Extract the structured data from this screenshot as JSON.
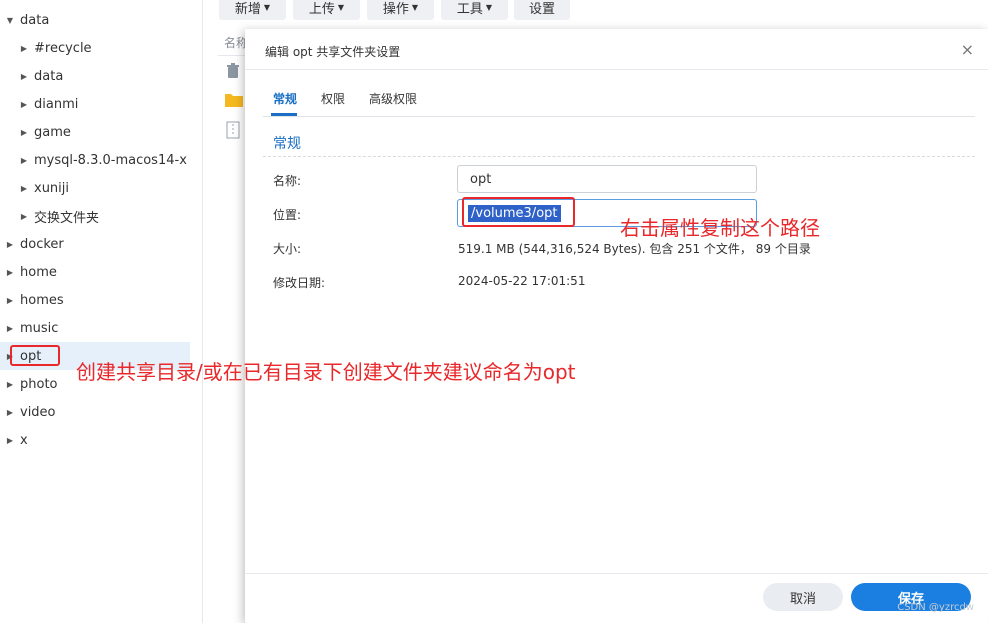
{
  "tree": {
    "items": [
      {
        "label": "data",
        "level": 0,
        "expanded": true
      },
      {
        "label": "#recycle",
        "level": 1
      },
      {
        "label": "data",
        "level": 1
      },
      {
        "label": "dianmi",
        "level": 1
      },
      {
        "label": "game",
        "level": 1
      },
      {
        "label": "mysql-8.3.0-macos14-x",
        "level": 1
      },
      {
        "label": "xuniji",
        "level": 1
      },
      {
        "label": "交换文件夹",
        "level": 1
      },
      {
        "label": "docker",
        "level": 0
      },
      {
        "label": "home",
        "level": 0
      },
      {
        "label": "homes",
        "level": 0
      },
      {
        "label": "music",
        "level": 0
      },
      {
        "label": "opt",
        "level": 0,
        "selected": true
      },
      {
        "label": "photo",
        "level": 0
      },
      {
        "label": "video",
        "level": 0
      },
      {
        "label": "x",
        "level": 0
      }
    ]
  },
  "toolbar": {
    "new_label": "新增",
    "upload_label": "上传",
    "action_label": "操作",
    "tools_label": "工具",
    "settings_label": "设置"
  },
  "filelist": {
    "header": "名称"
  },
  "dialog": {
    "title": "编辑 opt 共享文件夹设置",
    "close": "×",
    "tabs": [
      "常规",
      "权限",
      "高级权限"
    ],
    "section_title": "常规",
    "name_label": "名称:",
    "name_value": "opt",
    "location_label": "位置:",
    "location_value": "/volume3/opt",
    "size_label": "大小:",
    "size_value": "519.1 MB (544,316,524 Bytes). 包含 251 个文件， 89 个目录",
    "modified_label": "修改日期:",
    "modified_value": "2024-05-22 17:01:51",
    "cancel_label": "取消",
    "save_label": "保存"
  },
  "annotations": {
    "copy_path": "右击属性复制这个路径",
    "create_dir": "创建共享目录/或在已有目录下创建文件夹建议命名为opt"
  },
  "watermark": "CSDN @yzrcdw",
  "colors": {
    "accent": "#1a6fc4",
    "annotation_red": "#e8282a",
    "selected_bg": "#e6f0fb"
  }
}
